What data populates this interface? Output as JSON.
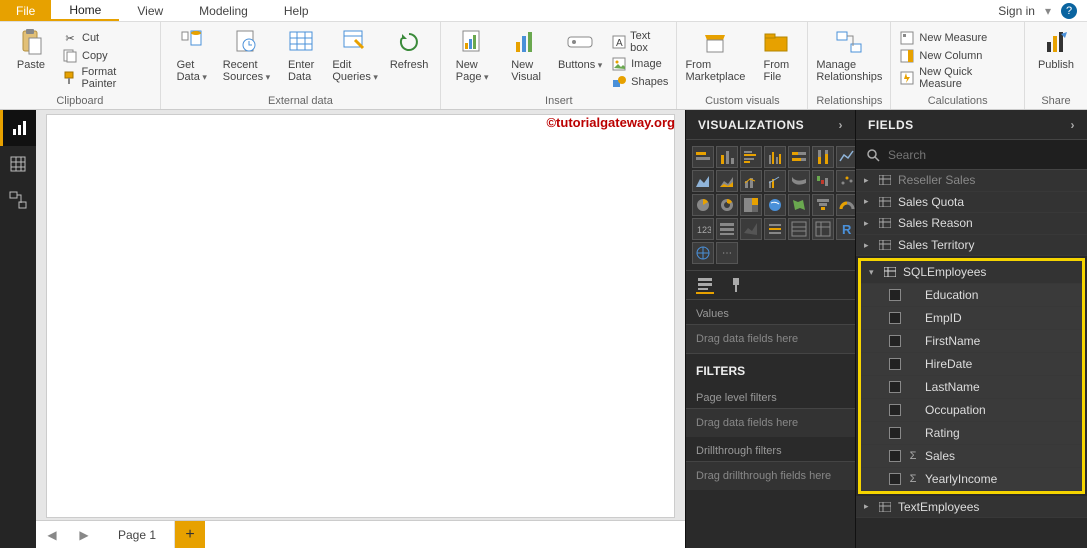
{
  "menubar": {
    "file": "File",
    "tabs": [
      "Home",
      "View",
      "Modeling",
      "Help"
    ],
    "signin": "Sign in"
  },
  "ribbon": {
    "clipboard": {
      "paste": "Paste",
      "cut": "Cut",
      "copy": "Copy",
      "format_painter": "Format Painter",
      "group": "Clipboard"
    },
    "external": {
      "get_data": "Get\nData",
      "recent": "Recent\nSources",
      "enter": "Enter\nData",
      "edit_q": "Edit\nQueries",
      "refresh": "Refresh",
      "group": "External data"
    },
    "insert": {
      "new_page": "New\nPage",
      "new_visual": "New\nVisual",
      "buttons": "Buttons",
      "text_box": "Text box",
      "image": "Image",
      "shapes": "Shapes",
      "group": "Insert"
    },
    "custom": {
      "marketplace": "From\nMarketplace",
      "file": "From\nFile",
      "group": "Custom visuals"
    },
    "rel": {
      "manage": "Manage\nRelationships",
      "group": "Relationships"
    },
    "calc": {
      "measure": "New Measure",
      "column": "New Column",
      "quick": "New Quick Measure",
      "group": "Calculations"
    },
    "share": {
      "publish": "Publish",
      "group": "Share"
    }
  },
  "watermark": "©tutorialgateway.org",
  "pagetab": "Page 1",
  "viz": {
    "title": "VISUALIZATIONS",
    "values_label": "Values",
    "values_drop": "Drag data fields here",
    "filters_title": "FILTERS",
    "page_filters": "Page level filters",
    "page_drop": "Drag data fields here",
    "drill_filters": "Drillthrough filters",
    "drill_drop": "Drag drillthrough fields here"
  },
  "fields": {
    "title": "FIELDS",
    "search_placeholder": "Search",
    "tables_before": [
      "Reseller Sales",
      "Sales Quota",
      "Sales Reason",
      "Sales Territory"
    ],
    "expanded_table": "SQLEmployees",
    "expanded_fields": [
      {
        "name": "Education",
        "agg": ""
      },
      {
        "name": "EmpID",
        "agg": ""
      },
      {
        "name": "FirstName",
        "agg": ""
      },
      {
        "name": "HireDate",
        "agg": ""
      },
      {
        "name": "LastName",
        "agg": ""
      },
      {
        "name": "Occupation",
        "agg": ""
      },
      {
        "name": "Rating",
        "agg": ""
      },
      {
        "name": "Sales",
        "agg": "Σ"
      },
      {
        "name": "YearlyIncome",
        "agg": "Σ"
      }
    ],
    "tables_after": [
      "TextEmployees"
    ]
  }
}
